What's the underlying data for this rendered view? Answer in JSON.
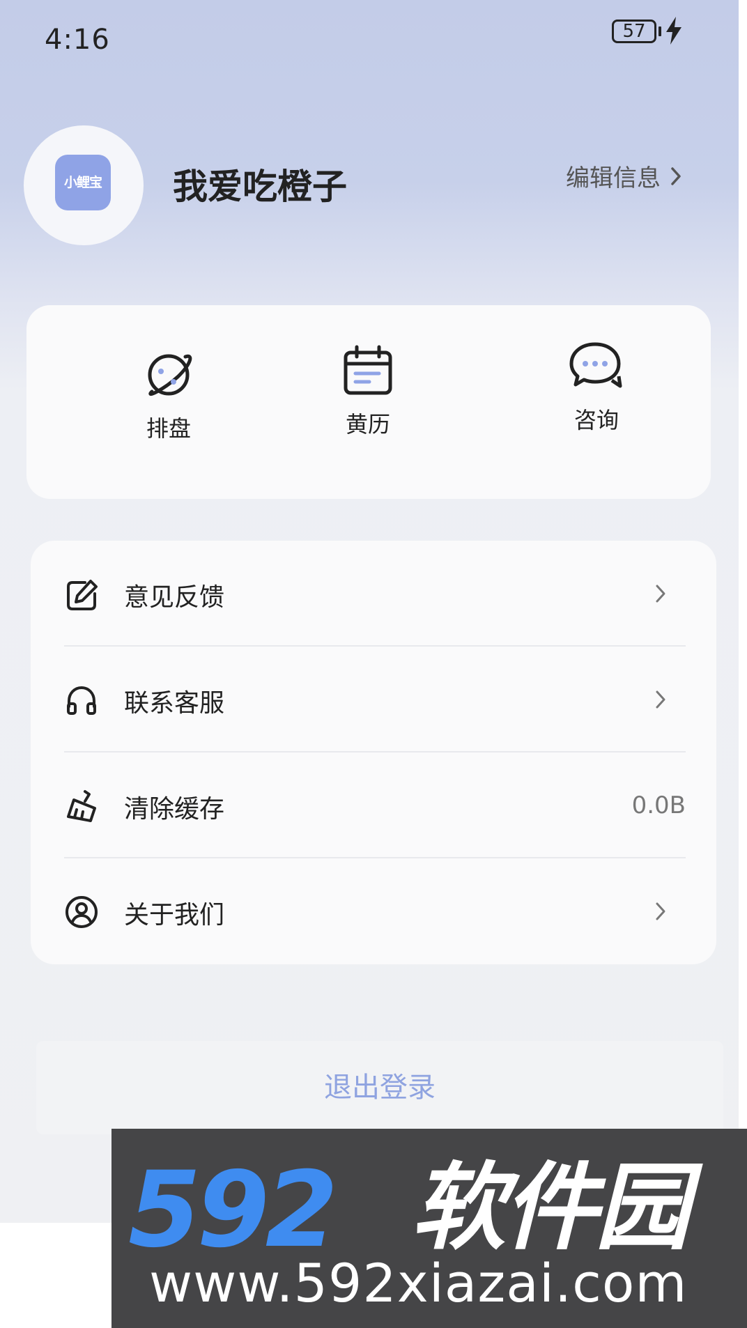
{
  "status_bar": {
    "time": "4:16",
    "battery": "57"
  },
  "profile": {
    "avatar_logo_text": "小鲤宝",
    "username": "我爱吃橙子",
    "edit_label": "编辑信息"
  },
  "quick_actions": [
    {
      "label": "排盘",
      "icon": "planet-icon"
    },
    {
      "label": "黄历",
      "icon": "calendar-icon"
    },
    {
      "label": "咨询",
      "icon": "chat-bubbles-icon"
    }
  ],
  "menu": [
    {
      "label": "意见反馈",
      "icon": "edit-note-icon",
      "value": ""
    },
    {
      "label": "联系客服",
      "icon": "headset-icon",
      "value": ""
    },
    {
      "label": "清除缓存",
      "icon": "broom-icon",
      "value": "0.0B"
    },
    {
      "label": "关于我们",
      "icon": "user-circle-icon",
      "value": ""
    }
  ],
  "logout_label": "退出登录",
  "watermark": {
    "number": "592",
    "name": "软件园",
    "url": "www.592xiazai.com"
  },
  "colors": {
    "accent": "#8fa3e6",
    "logout_text": "#8fa3e0",
    "watermark_blue": "#3f8cf0"
  }
}
